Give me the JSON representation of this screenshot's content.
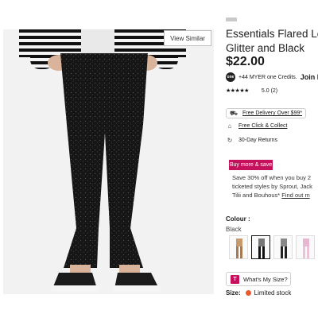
{
  "product": {
    "title": "Essentials Flared Leggings in Glitter and Black",
    "price": "$22.00",
    "view_similar_label": "View Similar",
    "credits_badge": "one",
    "credits_text": "+44 MYER one Credits.",
    "join_label": "Join N",
    "stars": "★★★★★",
    "rating": "5.0 (2)"
  },
  "delivery": [
    {
      "icon": "truck-icon",
      "glyph": "⛟",
      "label": "Free Delivery Over $99*"
    },
    {
      "icon": "store-icon",
      "glyph": "⌂",
      "label": "Free Click & Collect"
    },
    {
      "icon": "return-icon",
      "glyph": "↻",
      "label": "30-Day Returns"
    }
  ],
  "promo": {
    "button_label": "Buy more & save",
    "line1": "Save 30% off when you buy 2",
    "line2": "ticketed styles by Sprout, Jack",
    "line3_prefix": "Tilii and Bouhous* ",
    "line3_link": "Find out m"
  },
  "colour": {
    "label": "Colour :",
    "value": "Black"
  },
  "size": {
    "whats_my_size": "What's My Size?",
    "t_badge": "T",
    "label": "Size:",
    "stock": "Limited stock"
  },
  "colors": {
    "accent": "#c5115b",
    "stock_dot": "#e85a2c"
  }
}
